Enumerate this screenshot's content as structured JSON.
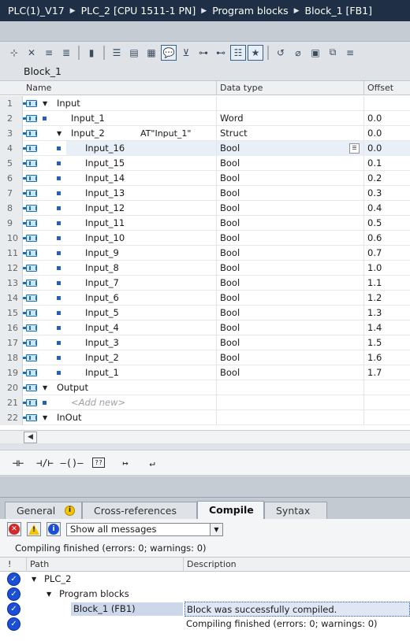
{
  "breadcrumb": [
    "PLC(1)_V17",
    "PLC_2 [CPU 1511-1 PN]",
    "Program blocks",
    "Block_1 [FB1]"
  ],
  "block_title": "Block_1",
  "table": {
    "headers": {
      "name": "Name",
      "data_type": "Data type",
      "offset": "Offset"
    },
    "rows": [
      {
        "num": "1",
        "name": "Input",
        "type": "",
        "offset": ""
      },
      {
        "num": "2",
        "name": "Input_1",
        "type": "Word",
        "offset": "0.0"
      },
      {
        "num": "3",
        "name": "Input_2",
        "at": "AT\"Input_1\"",
        "type": "Struct",
        "offset": "0.0"
      },
      {
        "num": "4",
        "name": "Input_16",
        "type": "Bool",
        "offset": "0.0"
      },
      {
        "num": "5",
        "name": "Input_15",
        "type": "Bool",
        "offset": "0.1"
      },
      {
        "num": "6",
        "name": "Input_14",
        "type": "Bool",
        "offset": "0.2"
      },
      {
        "num": "7",
        "name": "Input_13",
        "type": "Bool",
        "offset": "0.3"
      },
      {
        "num": "8",
        "name": "Input_12",
        "type": "Bool",
        "offset": "0.4"
      },
      {
        "num": "9",
        "name": "Input_11",
        "type": "Bool",
        "offset": "0.5"
      },
      {
        "num": "10",
        "name": "Input_10",
        "type": "Bool",
        "offset": "0.6"
      },
      {
        "num": "11",
        "name": "Input_9",
        "type": "Bool",
        "offset": "0.7"
      },
      {
        "num": "12",
        "name": "Input_8",
        "type": "Bool",
        "offset": "1.0"
      },
      {
        "num": "13",
        "name": "Input_7",
        "type": "Bool",
        "offset": "1.1"
      },
      {
        "num": "14",
        "name": "Input_6",
        "type": "Bool",
        "offset": "1.2"
      },
      {
        "num": "15",
        "name": "Input_5",
        "type": "Bool",
        "offset": "1.3"
      },
      {
        "num": "16",
        "name": "Input_4",
        "type": "Bool",
        "offset": "1.4"
      },
      {
        "num": "17",
        "name": "Input_3",
        "type": "Bool",
        "offset": "1.5"
      },
      {
        "num": "18",
        "name": "Input_2",
        "type": "Bool",
        "offset": "1.6"
      },
      {
        "num": "19",
        "name": "Input_1",
        "type": "Bool",
        "offset": "1.7"
      },
      {
        "num": "20",
        "name": "Output",
        "type": "",
        "offset": ""
      },
      {
        "num": "21",
        "name": "<Add new>",
        "type": "",
        "offset": ""
      },
      {
        "num": "22",
        "name": "InOut",
        "type": "",
        "offset": ""
      }
    ]
  },
  "lad_elements": [
    "normally-open-contact",
    "normally-closed-contact",
    "output-coil",
    "empty-box",
    "open-branch",
    "close-branch"
  ],
  "inspector": {
    "tabs": [
      "General",
      "Cross-references",
      "Compile",
      "Syntax"
    ],
    "active_tab": "Compile",
    "filter_value": "Show all messages",
    "status": "Compiling finished (errors: 0; warnings: 0)",
    "columns": {
      "bang": "!",
      "path": "Path",
      "description": "Description"
    },
    "messages": [
      {
        "path": "PLC_2",
        "description": ""
      },
      {
        "path": "Program blocks",
        "description": ""
      },
      {
        "path": "Block_1 (FB1)",
        "description": "Block was successfully compiled."
      },
      {
        "path": "",
        "description": "Compiling finished (errors: 0; warnings: 0)"
      }
    ]
  },
  "colors": {
    "titlebar": "#1f2f45",
    "accent": "#1b4fd6",
    "variable_icon": "#1b6fb5"
  }
}
